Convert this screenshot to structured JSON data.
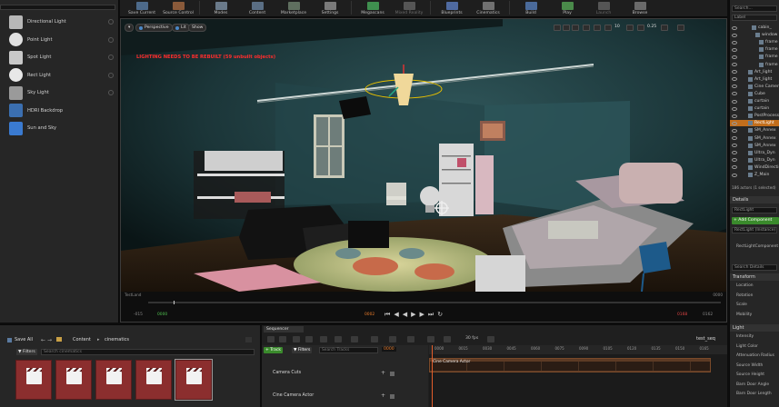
{
  "toolbar": {
    "items": [
      {
        "label": "Save Current",
        "color": "#4d6a8a"
      },
      {
        "label": "Source Control",
        "color": "#8a5a3a"
      },
      {
        "label": "Modes",
        "color": "#6a7a8a"
      },
      {
        "label": "Content",
        "color": "#5a6e84"
      },
      {
        "label": "Marketplace",
        "color": "#5f6f5f"
      },
      {
        "label": "Settings",
        "color": "#7a7a7a"
      },
      {
        "label": "Megascans",
        "color": "#3f8f4f"
      },
      {
        "label": "Mixed Reality",
        "color": "#555555"
      },
      {
        "label": "Blueprints",
        "color": "#4f6aa0"
      },
      {
        "label": "Cinematics",
        "color": "#707070"
      },
      {
        "label": "Build",
        "color": "#4a6a9a"
      },
      {
        "label": "Play",
        "color": "#4a8a4a"
      },
      {
        "label": "Launch",
        "color": "#555555"
      },
      {
        "label": "Browse",
        "color": "#6a6a6a"
      }
    ]
  },
  "place_panel": {
    "items": [
      {
        "label": "Directional Light",
        "icon": "directional-light-icon",
        "color": "#b8b8b8"
      },
      {
        "label": "Point Light",
        "icon": "point-light-icon",
        "color": "#e0e0e0"
      },
      {
        "label": "Spot Light",
        "icon": "spot-light-icon",
        "color": "#c8c8c8"
      },
      {
        "label": "Rect Light",
        "icon": "rect-light-icon",
        "color": "#e8e8e8"
      },
      {
        "label": "Sky Light",
        "icon": "sky-light-icon",
        "color": "#9a9a9a"
      },
      {
        "label": "HDRI Backdrop",
        "icon": "hdri-backdrop-icon",
        "color": "#3b6fb0"
      },
      {
        "label": "Sun and Sky",
        "icon": "sun-and-sky-icon",
        "color": "#3a7ad0"
      }
    ]
  },
  "viewport": {
    "perspective_label": "Perspective",
    "lit_label": "Lit",
    "show_label": "Show",
    "warning": "LIGHTING NEEDS TO BE REBUILT (59 unbuilt objects)",
    "scale_value": "0.25",
    "snap_value": "10",
    "start_frame": "0000",
    "end_frame": "0000",
    "left_label": "TestLand",
    "transport_left_a": "-015",
    "transport_left_b": "0000",
    "transport_mid": "0002",
    "transport_right_a": "0168",
    "transport_right_b": "0162"
  },
  "outliner": {
    "search_placeholder": "Search...",
    "label_header": "Label",
    "rows": [
      {
        "label": "cabin_",
        "indent": 14
      },
      {
        "label": "window",
        "indent": 18
      },
      {
        "label": "frame",
        "indent": 22
      },
      {
        "label": "frame",
        "indent": 22
      },
      {
        "label": "frame",
        "indent": 22
      },
      {
        "label": "frame",
        "indent": 22
      },
      {
        "label": "Art_light",
        "indent": 10
      },
      {
        "label": "Art_light",
        "indent": 10
      },
      {
        "label": "Cine Camera",
        "indent": 10
      },
      {
        "label": "Cube",
        "indent": 10
      },
      {
        "label": "curtain",
        "indent": 10
      },
      {
        "label": "curtain",
        "indent": 10
      },
      {
        "label": "PostProcess",
        "indent": 10
      },
      {
        "label": "RectLight",
        "indent": 10,
        "selected": true
      },
      {
        "label": "SM_Annex",
        "indent": 10
      },
      {
        "label": "SM_Annex",
        "indent": 10
      },
      {
        "label": "SM_Annex",
        "indent": 10
      },
      {
        "label": "Ultra_Dyn",
        "indent": 10
      },
      {
        "label": "Ultra_Dyn",
        "indent": 10
      },
      {
        "label": "WindDirectional",
        "indent": 10
      },
      {
        "label": "Z_Main",
        "indent": 10
      }
    ],
    "footer": "186 actors (1 selected)"
  },
  "details": {
    "title": "Details",
    "actor_name": "RectLight",
    "add_component": "+ Add Component",
    "component_root": "RectLight (Instance)",
    "component_child": "RectLightComponent",
    "search_details": "Search Details",
    "transform_header": "Transform",
    "transform_props": [
      "Location",
      "Rotation",
      "Scale",
      "Mobility"
    ],
    "light_header": "Light",
    "light_props": [
      "Intensity",
      "Light Color",
      "Attenuation Radius",
      "Source Width",
      "Source Height",
      "Barn Door Angle",
      "Barn Door Length"
    ]
  },
  "content_browser": {
    "tab_label": "Content Browser",
    "save_all": "Save All",
    "path_root": "Content",
    "path_folder": "cinematics",
    "filters_label": "Filters",
    "search_placeholder": "Search cinematics",
    "thumb_color": "#8b2e2e"
  },
  "sequencer": {
    "tab_label": "Sequencer",
    "track_button": "+ Track",
    "filters_label": "Filters",
    "search_placeholder": "Search Tracks",
    "fps_label": "30 fps",
    "current_frame": "0000",
    "sequence_name": "test_seq",
    "ruler_labels": [
      "0000",
      "0015",
      "0030",
      "0045",
      "0060",
      "0075",
      "0090",
      "0105",
      "0120",
      "0135",
      "0150",
      "0165"
    ],
    "tracks": [
      {
        "label": "Camera Cuts"
      },
      {
        "label": "Cine Camera Actor"
      }
    ],
    "section_label": "Cine Camera Actor",
    "bottom_left": "-015",
    "bottom_mid": "-015",
    "bottom_right": "0168",
    "bottom_right2": "0182"
  }
}
